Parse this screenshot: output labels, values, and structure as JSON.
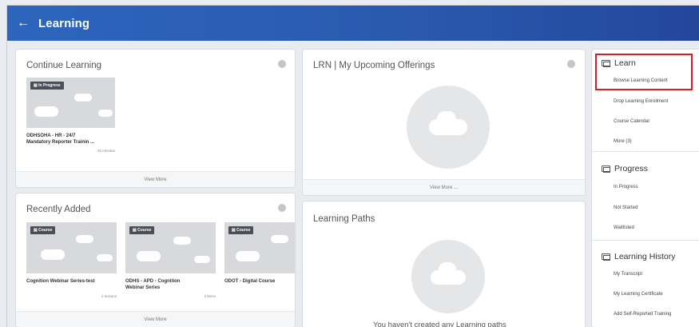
{
  "header": {
    "back_icon": "←",
    "title": "Learning"
  },
  "continue_learning": {
    "title": "Continue Learning",
    "badge": "In Progress",
    "item_title_1": "ODHSOHA - HR - 24/7",
    "item_title_2": "Mandatory Reporter Trainin ...",
    "item_meta": "45 minutes",
    "footer": "View More"
  },
  "upcoming": {
    "title": "LRN | My Upcoming Offerings",
    "footer": "View More ..."
  },
  "recently_added": {
    "title": "Recently Added",
    "items": [
      {
        "badge": "Course",
        "title_1": "Cognition Webinar Series-test",
        "title_2": "",
        "meta": "2 lessons"
      },
      {
        "badge": "Course",
        "title_1": "ODHS - APD - Cognition",
        "title_2": "Webinar Series",
        "meta": "3 items"
      },
      {
        "badge": "Course",
        "title_1": "ODOT - Digital Course",
        "title_2": "",
        "meta": ""
      }
    ],
    "footer": "View More"
  },
  "learning_paths": {
    "title": "Learning Paths",
    "empty_text": "You haven't created any Learning paths"
  },
  "sidebar": {
    "learn": {
      "title": "Learn",
      "links": [
        "Browse Learning Content",
        "Drop Learning Enrollment",
        "Course Calendar",
        "More (3)"
      ]
    },
    "progress": {
      "title": "Progress",
      "links": [
        "In Progress",
        "Not Started",
        "Waitlisted"
      ]
    },
    "history": {
      "title": "Learning History",
      "links": [
        "My Transcript",
        "My Learning Certificate",
        "Add Self-Reported Training"
      ]
    }
  },
  "colors": {
    "header": "#2a5ab0",
    "highlight": "#d32026"
  }
}
